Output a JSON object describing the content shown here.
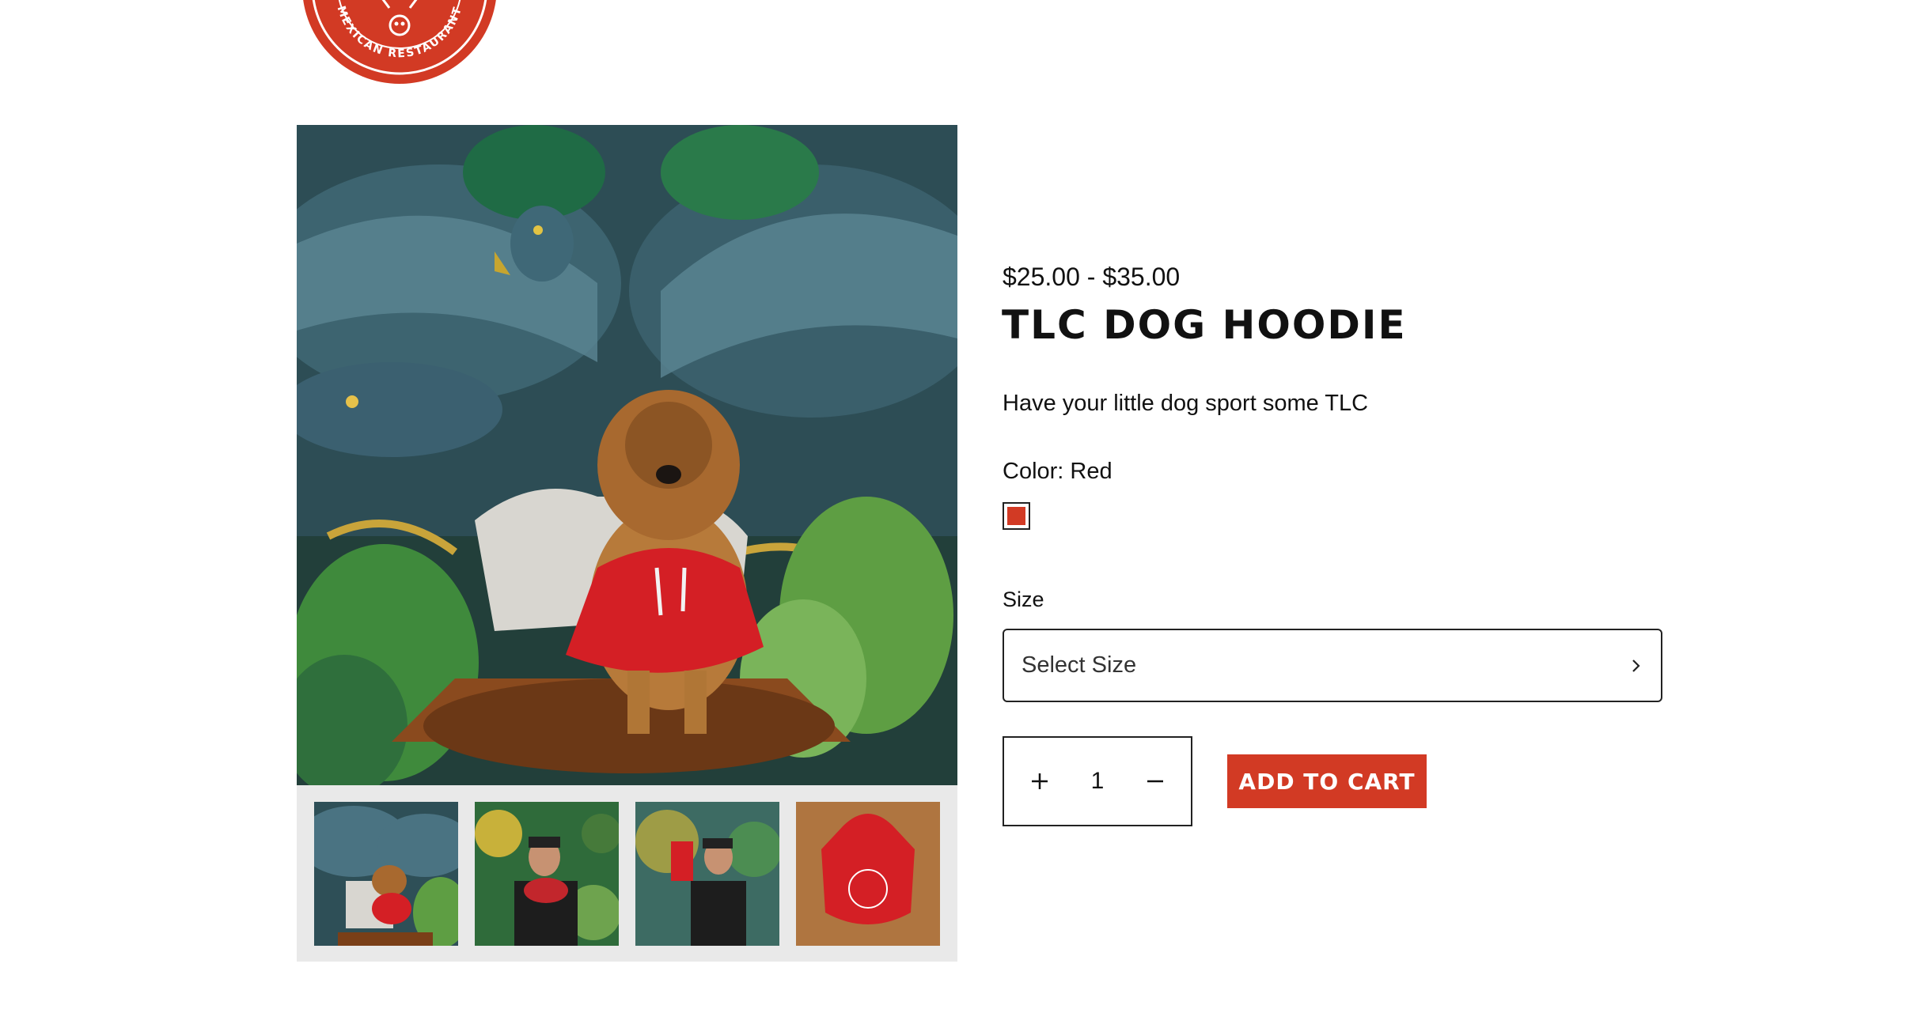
{
  "logo": {
    "text": "MEXICAN RESTAURANT"
  },
  "product": {
    "price": "$25.00 - $35.00",
    "title": "TLC DOG HOODIE",
    "description": "Have your little dog sport some TLC",
    "color_label": "Color: Red",
    "color_swatch": "#d23a24",
    "size_label": "Size",
    "size_placeholder": "Select Size",
    "quantity": "1",
    "add_to_cart_label": "ADD TO CART"
  },
  "gallery": {
    "thumbnails": [
      {
        "name": "dog-in-hoodie"
      },
      {
        "name": "man-holding-dog"
      },
      {
        "name": "man-holding-hoodie"
      },
      {
        "name": "hoodie-on-wood"
      }
    ]
  },
  "colors": {
    "accent": "#d23a24"
  }
}
